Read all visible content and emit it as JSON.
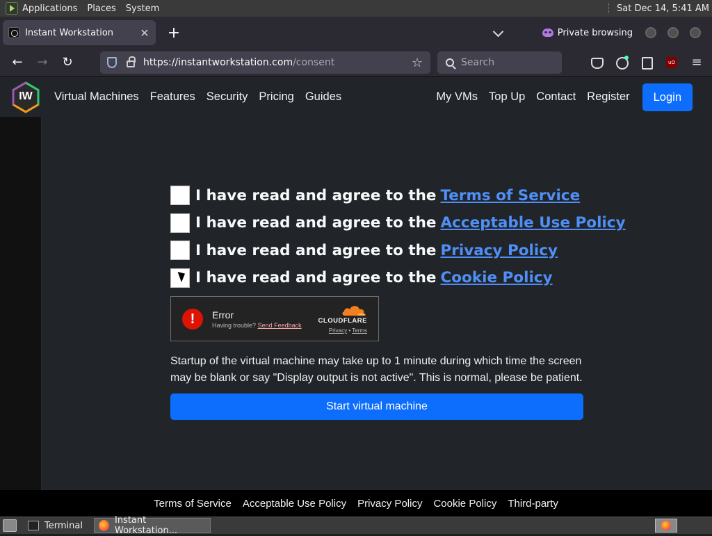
{
  "gnome_top": {
    "menus": [
      "Applications",
      "Places",
      "System"
    ],
    "clock": "Sat Dec 14,  5:41 AM"
  },
  "browser": {
    "tab_title": "Instant Workstation",
    "private_label": "Private browsing",
    "url_host": "https://instantworkstation.com",
    "url_path": "/consent",
    "search_placeholder": "Search"
  },
  "site": {
    "logo_text": "IW",
    "nav_left": [
      "Virtual Machines",
      "Features",
      "Security",
      "Pricing",
      "Guides"
    ],
    "nav_right": [
      "My VMs",
      "Top Up",
      "Contact",
      "Register"
    ],
    "login_label": "Login",
    "consent_prefix": "I have read and agree to the",
    "consents": [
      {
        "link": "Terms of Service"
      },
      {
        "link": "Acceptable Use Policy"
      },
      {
        "link": "Privacy Policy"
      },
      {
        "link": "Cookie Policy"
      }
    ],
    "captcha": {
      "title": "Error",
      "trouble": "Having trouble?",
      "feedback": "Send Feedback",
      "brand": "CLOUDFLARE",
      "privacy": "Privacy",
      "separator": "•",
      "terms": "Terms"
    },
    "startup_note": "Startup of the virtual machine may take up to 1 minute during which time the screen may be blank or say \"Display output is not active\". This is normal, please be patient.",
    "start_button": "Start virtual machine",
    "footer_links": [
      "Terms of Service",
      "Acceptable Use Policy",
      "Privacy Policy",
      "Cookie Policy",
      "Third-party"
    ]
  },
  "gnome_bottom": {
    "tasks": [
      "Terminal",
      "Instant Workstation..."
    ]
  },
  "colors": {
    "accent": "#0d6efd",
    "link": "#4f8ff7",
    "page_bg": "#212529",
    "error": "#de1303"
  }
}
